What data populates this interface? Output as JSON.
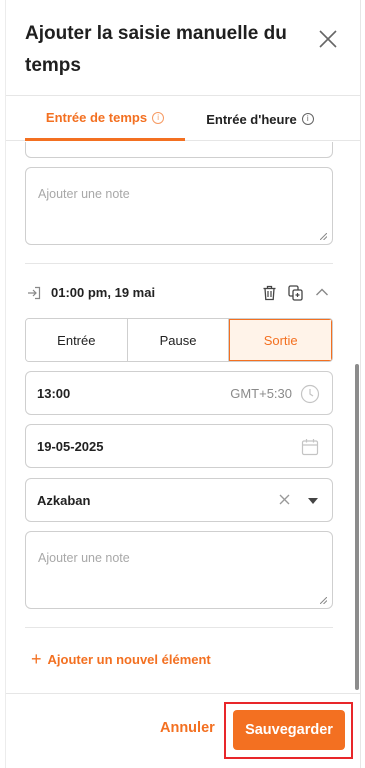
{
  "header": {
    "title": "Ajouter la saisie manuelle du temps"
  },
  "tabs": [
    {
      "label": "Entrée de temps",
      "active": true
    },
    {
      "label": "Entrée d'heure",
      "active": false
    }
  ],
  "previous_entry": {
    "note_placeholder": "Ajouter une note"
  },
  "entry": {
    "time_label": "01:00 pm, 19 mai",
    "segments": [
      "Entrée",
      "Pause",
      "Sortie"
    ],
    "selected_segment": "Sortie",
    "time_value": "13:00",
    "timezone": "GMT+5:30",
    "date_value": "19-05-2025",
    "location_value": "Azkaban",
    "note_placeholder": "Ajouter une note"
  },
  "add_item_label": "Ajouter un nouvel élément",
  "footer": {
    "cancel_label": "Annuler",
    "save_label": "Sauvegarder"
  },
  "colors": {
    "accent": "#f37021",
    "highlight_outline": "#e8262a"
  }
}
